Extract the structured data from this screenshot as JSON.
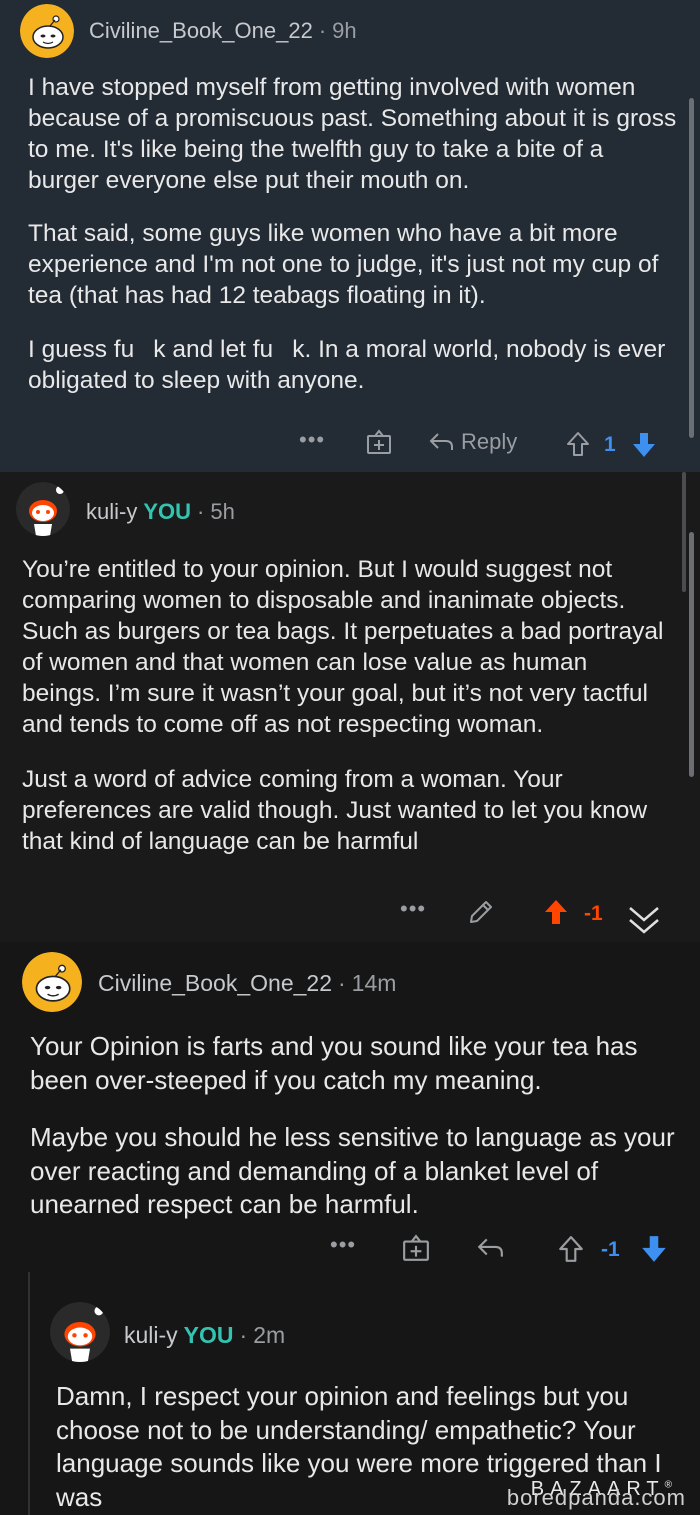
{
  "comments": [
    {
      "username": "Civiline_Book_One_22",
      "you": "",
      "time": "9h",
      "paragraphs": [
        "I have stopped myself from getting involved with women because of a promiscuous past. Something about it is gross to me. It's like being the twelfth guy to take a bite of a burger everyone else put their mouth on.",
        "That said, some guys like women who have a bit more experience and I'm not one to judge, it's just not my cup of tea (that has had 12 teabags floating in it).",
        "I guess fu  k and let fu  k. In a moral world, nobody is ever obligated to sleep with anyone."
      ],
      "reply_label": "Reply",
      "score": "1",
      "avatar_color": "#f5b21e"
    },
    {
      "username": "kuli-y",
      "you": "YOU",
      "time": "5h",
      "paragraphs": [
        "You’re entitled to your opinion. But I would suggest not comparing women to disposable and inanimate objects. Such as burgers or tea bags. It perpetuates a bad portrayal of women and that women can lose value as human beings. I’m sure it wasn’t your goal, but it’s not very tactful and tends to come off as not respecting woman.",
        "Just a word of advice coming from a woman. Your preferences are valid though. Just wanted to let you know that kind of language can be harmful"
      ],
      "score": "-1",
      "avatar_color": "#ff4500"
    },
    {
      "username": "Civiline_Book_One_22",
      "you": "",
      "time": "14m",
      "paragraphs": [
        "Your Opinion is farts and you sound like your tea has been over-steeped if you catch my meaning.",
        "Maybe you should he less sensitive to language as your over reacting and demanding of a blanket level of unearned respect can be harmful."
      ],
      "score": "-1",
      "avatar_color": "#f5b21e"
    },
    {
      "username": "kuli-y",
      "you": "YOU",
      "time": "2m",
      "paragraphs": [
        "Damn, I respect your opinion and feelings but you choose not to be understanding/ empathetic? Your language sounds like you were more triggered than I was"
      ],
      "avatar_color": "#ff4500"
    }
  ],
  "colors": {
    "upvote_orange": "#ff4500",
    "downvote_blue": "#3d8ff0",
    "you_teal": "#33c3b0"
  },
  "watermark": "boredpanda.com",
  "watermark2": "BAZAART",
  "watermark2_mark": "®"
}
